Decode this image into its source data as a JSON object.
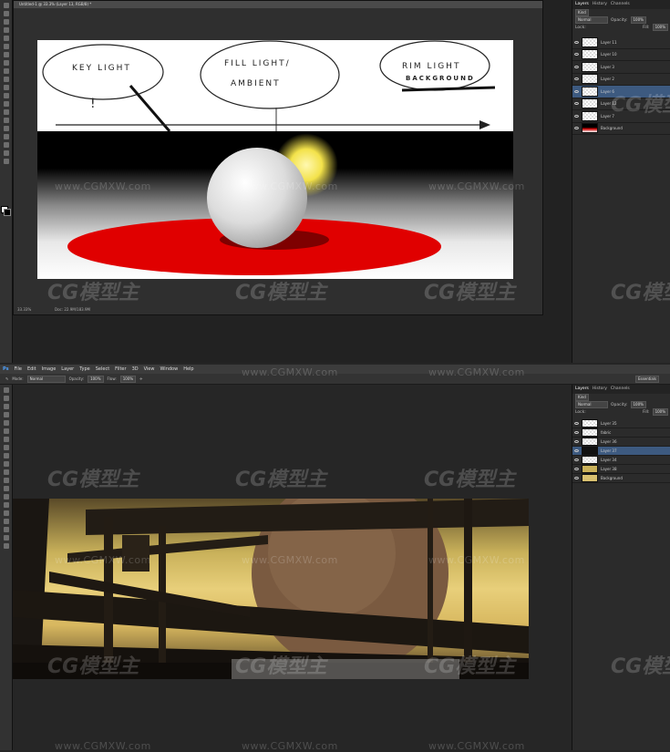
{
  "top_window": {
    "doc_tab": "Untitled-1 @ 33.3% (Layer 13, RGB/8) *",
    "zoom": "33.33%",
    "doc_info": "Doc: 22.9M/183.9M",
    "labels": {
      "key_light": "KEY LIGHT",
      "fill_light": "FILL LIGHT/",
      "ambient": "AMBIENT",
      "rim_light": "RIM LIGHT",
      "background": "BACKGROUND",
      "exclaim": "!"
    },
    "panel_tabs": [
      "Layers",
      "History",
      "Channels"
    ],
    "kind": "Kind",
    "blend": "Normal",
    "opacity_label": "Opacity:",
    "opacity": "100%",
    "lock_label": "Lock:",
    "fill_label": "Fill:",
    "fill": "100%",
    "layers": [
      "Layer 11",
      "Layer 10",
      "Layer 3",
      "Layer 2",
      "Layer 6",
      "Layer 12",
      "Layer 7",
      "Background"
    ]
  },
  "bottom_window": {
    "app_icon": "Ps",
    "menu": [
      "File",
      "Edit",
      "Image",
      "Layer",
      "Type",
      "Select",
      "Filter",
      "3D",
      "View",
      "Window",
      "Help"
    ],
    "options": {
      "mode_label": "Mode:",
      "mode": "Normal",
      "opacity_label": "Opacity:",
      "opacity": "100%",
      "flow_label": "Flow:",
      "flow": "100%"
    },
    "workspace": "Essentials",
    "panel_tabs": [
      "Layers",
      "History",
      "Channels"
    ],
    "kind": "Kind",
    "blend": "Normal",
    "opacity_label": "Opacity:",
    "opacity": "100%",
    "lock_label": "Lock:",
    "fill_label": "Fill:",
    "fill": "100%",
    "layers": [
      "Layer 35",
      "fabric",
      "Layer 36",
      "Layer 37",
      "Layer 34",
      "Layer 38",
      "Background"
    ]
  },
  "watermarks": {
    "logo": "CG模型主",
    "url": "www.CGMXW.com"
  },
  "colors": {
    "ui_dark": "#252525",
    "panel": "#2b2b2b",
    "red_floor": "#e00000",
    "sun_yellow": "#f3e24a",
    "sky": "#c9b15a"
  }
}
